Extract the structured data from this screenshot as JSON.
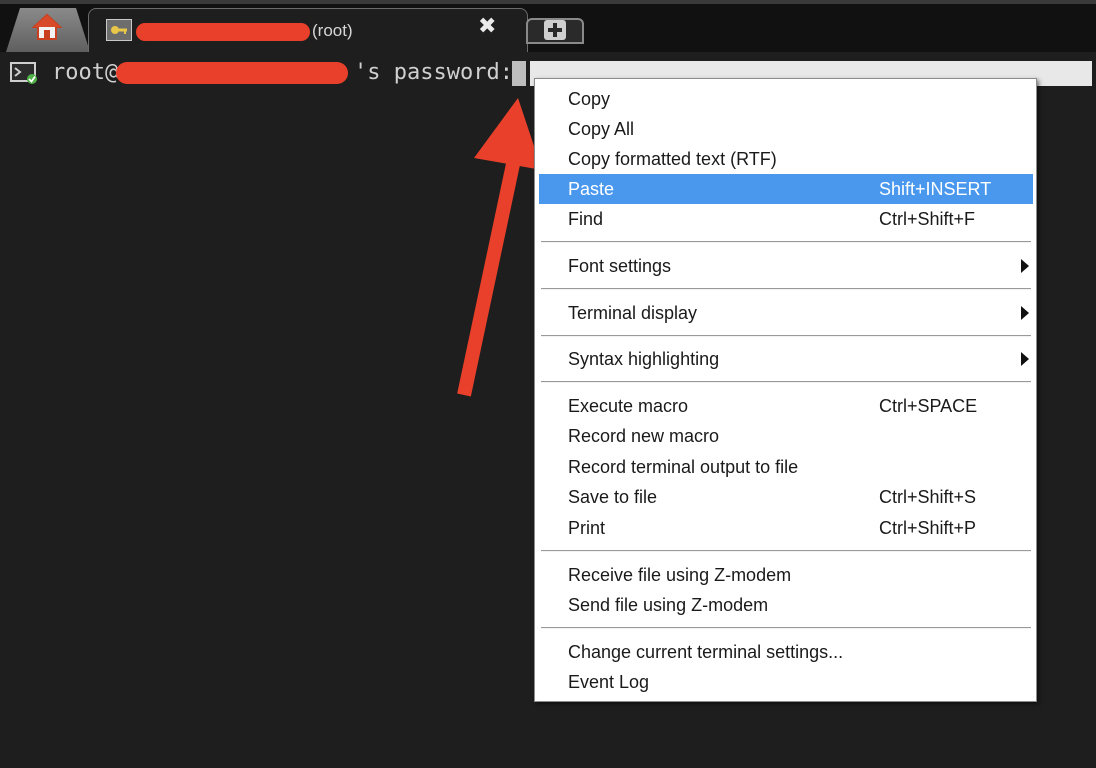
{
  "tabbar": {
    "home_icon": "home-icon",
    "tab": {
      "title_suffix": "(root)",
      "icon": "key-icon",
      "close_glyph": "✖"
    },
    "new_tab_icon": "plus-icon"
  },
  "terminal": {
    "prompt_user": "root@",
    "prompt_end": "'s password:"
  },
  "context_menu": {
    "items": [
      {
        "label": "Copy",
        "shortcut": ""
      },
      {
        "label": "Copy All",
        "shortcut": ""
      },
      {
        "label": "Copy formatted text (RTF)",
        "shortcut": ""
      },
      {
        "label": "Paste",
        "shortcut": "Shift+INSERT",
        "selected": true
      },
      {
        "label": "Find",
        "shortcut": "Ctrl+Shift+F"
      },
      {
        "label": "Font settings",
        "submenu": true
      },
      {
        "label": "Terminal display",
        "submenu": true
      },
      {
        "label": "Syntax highlighting",
        "submenu": true
      },
      {
        "label": "Execute macro",
        "shortcut": "Ctrl+SPACE"
      },
      {
        "label": "Record new macro",
        "shortcut": ""
      },
      {
        "label": "Record terminal output to file",
        "shortcut": ""
      },
      {
        "label": "Save to file",
        "shortcut": "Ctrl+Shift+S"
      },
      {
        "label": "Print",
        "shortcut": "Ctrl+Shift+P"
      },
      {
        "label": "Receive file using Z-modem",
        "shortcut": ""
      },
      {
        "label": "Send file using Z-modem",
        "shortcut": ""
      },
      {
        "label": "Change current terminal settings...",
        "shortcut": ""
      },
      {
        "label": "Event Log",
        "shortcut": ""
      }
    ]
  },
  "colors": {
    "selection": "#4a98ee",
    "annotation_arrow": "#e8402a",
    "terminal_bg": "#1e1e1e"
  }
}
